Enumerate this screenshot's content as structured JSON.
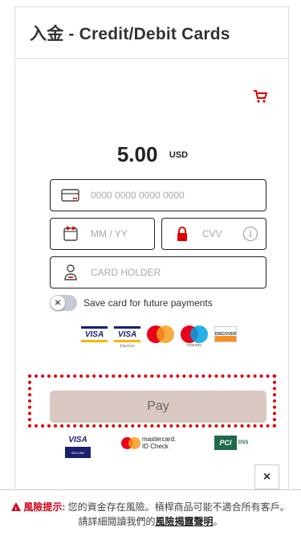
{
  "header": {
    "title": "入金 - Credit/Debit Cards"
  },
  "amount": {
    "value": "5.00",
    "currency": "USD"
  },
  "form": {
    "card_number_placeholder": "0000 0000 0000 0000",
    "expiry_placeholder": "MM / YY",
    "cvv_placeholder": "CVV",
    "holder_placeholder": "CARD HOLDER",
    "save_label": "Save card for future payments",
    "save_enabled": false
  },
  "brands": [
    "VISA",
    "VISA Electron",
    "Mastercard",
    "Maestro",
    "Discover"
  ],
  "brand_labels": {
    "visa": "VISA",
    "visa_electron": "VISA",
    "electron_sub": "Electron",
    "maestro_sub": "maestro",
    "discover": "DISCOVER"
  },
  "pay_button": {
    "label": "Pay"
  },
  "trust": {
    "visa": "VISA",
    "visa_secure": "SECURE",
    "mc_line1": "mastercard.",
    "mc_line2": "ID Check",
    "pci": "PCI",
    "dss": "DSS"
  },
  "close_label": "×",
  "risk": {
    "title": "風險提示:",
    "text": "您的資金存在風險。槓桿商品可能不適合所有客戶。請詳細閱讀我們的",
    "link": "風險揭露聲明",
    "end": "。"
  },
  "colors": {
    "accent_red": "#e00000",
    "pay_bg": "#d9c9c2",
    "visa_blue": "#1a1f71"
  }
}
